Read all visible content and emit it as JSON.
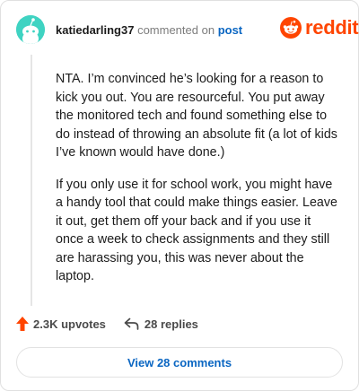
{
  "comment": {
    "username": "katiedarling37",
    "action_text": "commented on",
    "post_link": "post",
    "paragraphs": [
      "NTA. I’m convinced he’s looking for a reason to kick you out. You are resourceful. You put away the monitored tech and found something else to do instead of throwing an absolute fit (a lot of kids I’ve known would have done.)",
      "If you only use it for school work, you might have a handy tool that could make things easier. Leave it out, get them off your back and if you use it once a week to check assignments and they still are harassing you, this was never about the laptop."
    ]
  },
  "brand": {
    "name": "reddit",
    "color": "#ff4500",
    "icon": "reddit-alien-icon"
  },
  "footer": {
    "upvotes": "2.3K upvotes",
    "replies": "28 replies",
    "view_button": "View 28 comments"
  },
  "colors": {
    "link": "#0a66c2",
    "upvote": "#ff4500",
    "avatar": "#3fd3c2"
  }
}
